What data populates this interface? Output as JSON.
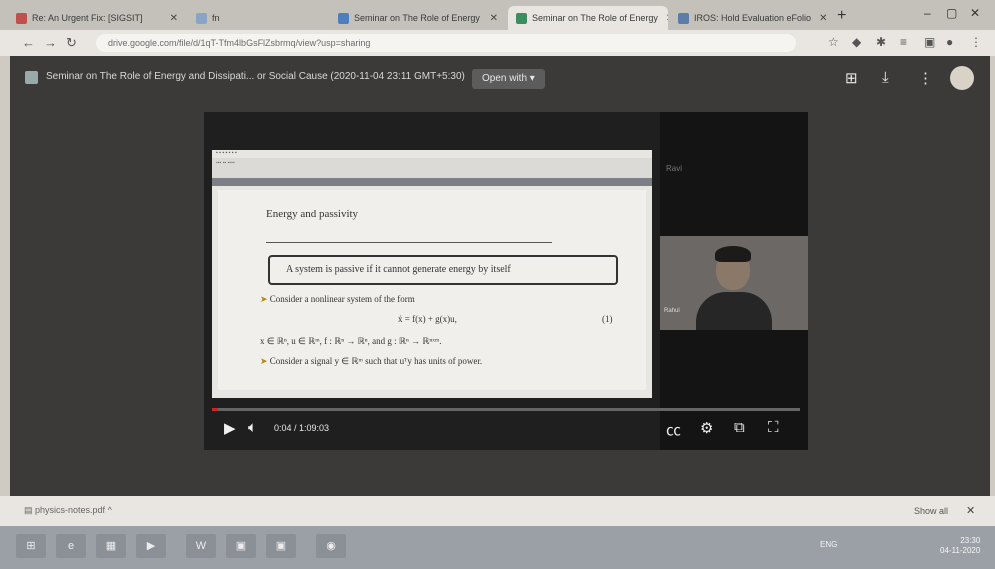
{
  "browser": {
    "tabs": [
      {
        "label": "Re: An Urgent Fix: [SIGSIT]",
        "icon": "mail-icon",
        "color": "#c0504d"
      },
      {
        "label": "fn",
        "icon": "drive-icon",
        "color": "#8aa4c8"
      },
      {
        "label": "Seminar on The Role of Energy",
        "icon": "meet-icon",
        "color": "#4d7fbf"
      },
      {
        "label": "Seminar on The Role of Energy",
        "icon": "drive-icon",
        "color": "#3c8d5f"
      },
      {
        "label": "IROS: Hold Evaluation eFolio",
        "icon": "globe-icon",
        "color": "#5b7da8"
      }
    ],
    "url": "drive.google.com/file/d/1qT-Tfm4lbGsFlZsbrmq/view?usp=sharing",
    "window_controls": [
      "–",
      "▢",
      "✕"
    ]
  },
  "viewer": {
    "file_title": "Seminar on The Role of Energy and Dissipati... or Social Cause (2020-11-04 23:11 GMT+5:30)",
    "open_with": "Open with ▾",
    "slide": {
      "title": "Energy and passivity",
      "box_text": "A system is passive if it cannot generate energy by itself",
      "line1": "Consider a nonlinear system of the form",
      "equation": "ẋ = f(x) + g(x)u,",
      "equation_number": "(1)",
      "line2": "x ∈ ℝⁿ, u ∈ ℝᵐ, f : ℝⁿ → ℝⁿ, and g : ℝⁿ → ℝⁿˣᵐ.",
      "line3": "Consider a signal y ∈ ℝᵐ such that uᵀy has units of power."
    },
    "webcam_name": "Rahul",
    "camera_label": "Ravi",
    "time": "0:04 / 1:09:03",
    "progress_fraction": 0.0,
    "accent": "#c62828"
  },
  "downloads": {
    "item": "physics-notes.pdf",
    "show_all": "Show all",
    "close": "✕"
  },
  "taskbar": {
    "tray": "ENG",
    "clock_time": "23:30",
    "clock_date": "04-11-2020"
  }
}
